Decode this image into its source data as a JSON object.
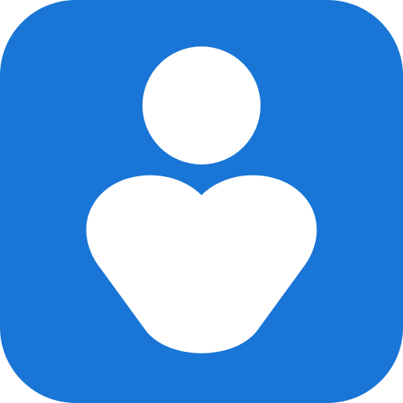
{
  "icon": {
    "name": "person-heart-icon",
    "background_color": "#1976D6",
    "foreground_color": "#FFFFFF"
  }
}
